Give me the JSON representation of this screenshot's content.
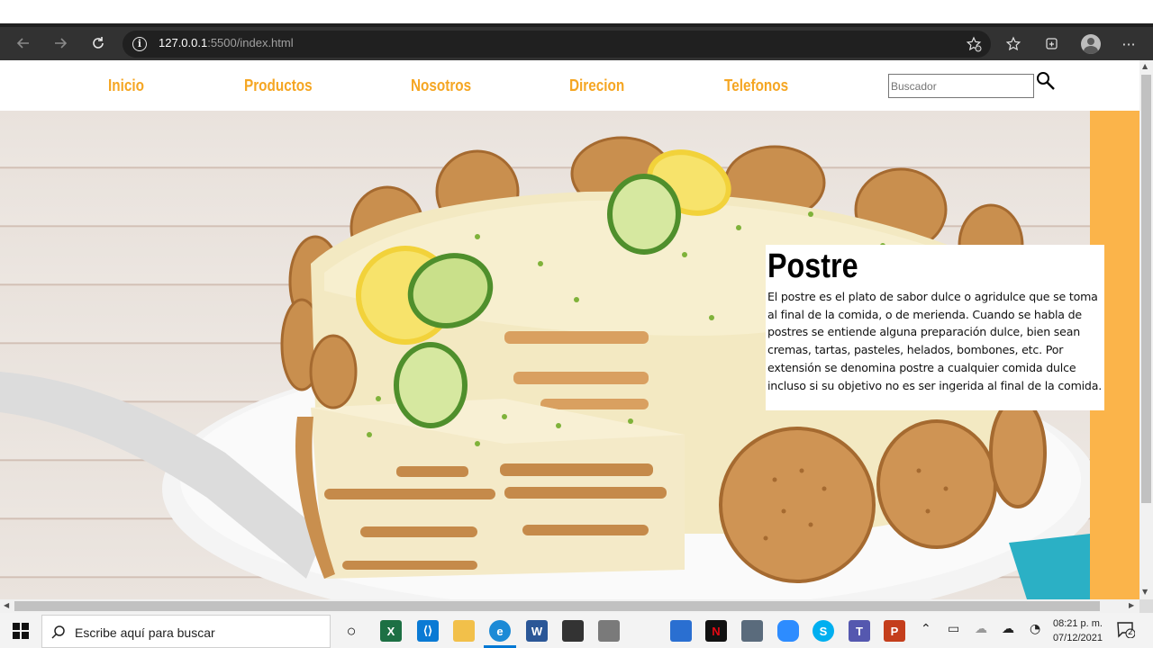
{
  "browser": {
    "url_host": "127.0.0.1",
    "url_rest": ":5500/index.html",
    "back_icon": "arrow-left-icon",
    "forward_icon": "arrow-right-icon",
    "refresh_icon": "refresh-icon",
    "more_label": "···"
  },
  "nav": {
    "items": [
      {
        "label": "Inicio"
      },
      {
        "label": "Productos"
      },
      {
        "label": "Nosotros"
      },
      {
        "label": "Direcion"
      },
      {
        "label": "Telefonos"
      }
    ],
    "search_placeholder": "Buscador",
    "accent_color": "#f5a623"
  },
  "article": {
    "title": "Postre",
    "body": "El postre es el plato de sabor dulce o agridulce que se toma al final de la comida, o de merienda. Cuando se habla de postres se entiende alguna preparación dulce, bien sean cremas, tartas, pasteles, helados, bombones, etc. Por extensión se denomina postre a cualquier comida dulce incluso si su objetivo no es ser ingerida al final de la comida."
  },
  "taskbar": {
    "search_placeholder": "Escribe aquí para buscar",
    "time": "08:21 p. m.",
    "date": "07/12/2021",
    "notification_count": "2"
  }
}
